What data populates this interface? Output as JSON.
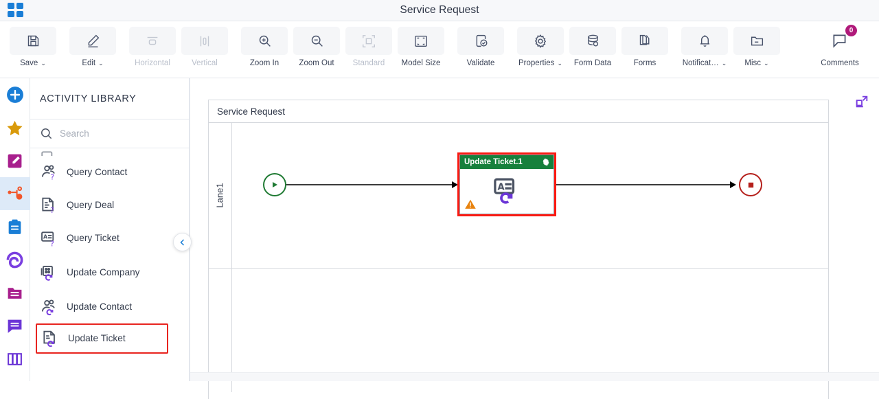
{
  "app": {
    "logo_icon": "grid-logo-icon",
    "title": "Service Request"
  },
  "toolbar": {
    "items": [
      {
        "label": "Save",
        "icon": "save-icon",
        "caret": "⌄",
        "disabled": false
      },
      {
        "label": "Edit",
        "icon": "pencil-icon",
        "caret": "⌄",
        "disabled": false
      },
      {
        "label": "Horizontal",
        "icon": "horizontal-align-icon",
        "caret": "",
        "disabled": true
      },
      {
        "label": "Vertical",
        "icon": "vertical-align-icon",
        "caret": "",
        "disabled": true
      },
      {
        "label": "Zoom In",
        "icon": "zoom-in-icon",
        "caret": "",
        "disabled": false
      },
      {
        "label": "Zoom Out",
        "icon": "zoom-out-icon",
        "caret": "",
        "disabled": false
      },
      {
        "label": "Standard",
        "icon": "standard-size-icon",
        "caret": "",
        "disabled": true
      },
      {
        "label": "Model Size",
        "icon": "model-size-icon",
        "caret": "",
        "disabled": false
      },
      {
        "label": "Validate",
        "icon": "validate-icon",
        "caret": "",
        "disabled": false
      },
      {
        "label": "Properties",
        "icon": "gear-icon",
        "caret": "⌄",
        "disabled": false
      },
      {
        "label": "Form Data",
        "icon": "database-icon",
        "caret": "",
        "disabled": false
      },
      {
        "label": "Forms",
        "icon": "forms-icon",
        "caret": "",
        "disabled": false
      },
      {
        "label": "Notificat…",
        "icon": "bell-icon",
        "caret": "⌄",
        "disabled": false
      },
      {
        "label": "Misc",
        "icon": "folder-icon",
        "caret": "⌄",
        "disabled": false
      }
    ],
    "comments": {
      "label": "Comments",
      "icon": "comment-icon",
      "badge": "0",
      "badge_color": "#b0197a"
    }
  },
  "rail": {
    "items": [
      {
        "name": "add-icon",
        "color": "#1a7ed6",
        "active": false
      },
      {
        "name": "star-icon",
        "color": "#d99a0b",
        "active": false
      },
      {
        "name": "edit-note-icon",
        "color": "#a81f8d",
        "active": false
      },
      {
        "name": "hubspot-icon",
        "color": "#f2562a",
        "active": true
      },
      {
        "name": "clipboard-icon",
        "color": "#1a7ed6",
        "active": false
      },
      {
        "name": "alfresco-icon",
        "color": "#7a3fe0",
        "active": false
      },
      {
        "name": "folder-icon",
        "color": "#a81f8d",
        "active": false
      },
      {
        "name": "chat-icon",
        "color": "#6b35d6",
        "active": false
      },
      {
        "name": "columns-icon",
        "color": "#6b35d6",
        "active": false
      }
    ]
  },
  "library": {
    "title": "ACTIVITY LIBRARY",
    "search": {
      "placeholder": "Search",
      "value": "",
      "icon": "search-icon"
    },
    "collapse_icon": "chevron-left-icon",
    "items": [
      {
        "label": "Query Contact",
        "icon": "query-contact-icon",
        "selected": false
      },
      {
        "label": "Query Deal",
        "icon": "query-deal-icon",
        "selected": false
      },
      {
        "label": "Query Ticket",
        "icon": "query-ticket-icon",
        "selected": false
      },
      {
        "label": "Update Company",
        "icon": "update-company-icon",
        "selected": false
      },
      {
        "label": "Update Contact",
        "icon": "update-contact-icon",
        "selected": false
      },
      {
        "label": "Update Ticket",
        "icon": "update-ticket-icon",
        "selected": true
      }
    ]
  },
  "canvas": {
    "pool_title": "Service Request",
    "lane_label": "Lane1",
    "expand_icon": "expand-icon",
    "nodes": {
      "start": {
        "name": "start-event",
        "icon": "play-icon",
        "color": "#1f7a33"
      },
      "end": {
        "name": "end-event",
        "icon": "stop-icon",
        "color": "#b5201c"
      },
      "task": {
        "title": "Update Ticket.1",
        "header_color": "#16803c",
        "selection_color": "#fa1a12",
        "gear_icon": "gear-icon",
        "body_icon": "update-ticket-icon",
        "warning_icon": "warning-icon",
        "warning_color": "#e8830f"
      }
    }
  }
}
